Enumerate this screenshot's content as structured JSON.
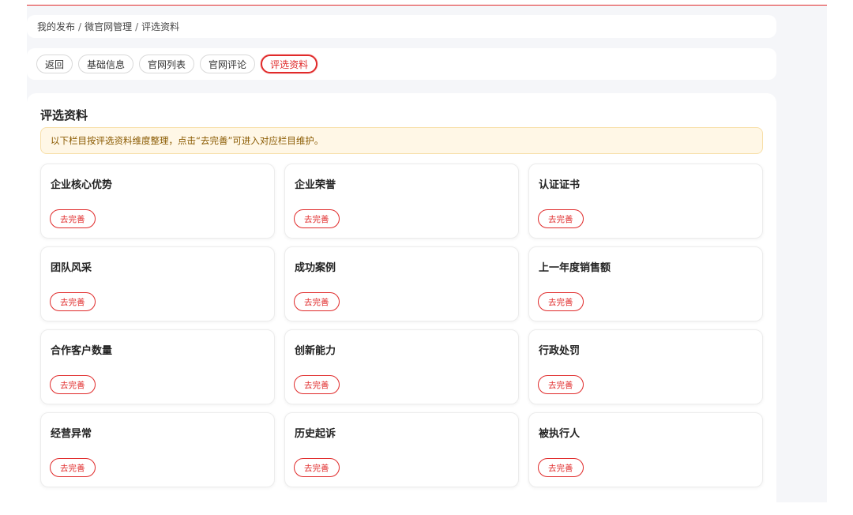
{
  "breadcrumb": {
    "items": [
      "我的发布",
      "微官网管理",
      "评选资料"
    ],
    "separator": "/"
  },
  "tabs": [
    {
      "label": "返回",
      "active": false
    },
    {
      "label": "基础信息",
      "active": false
    },
    {
      "label": "官网列表",
      "active": false
    },
    {
      "label": "官网评论",
      "active": false
    },
    {
      "label": "评选资料",
      "active": true
    }
  ],
  "panel": {
    "title": "评选资料",
    "notice": "以下栏目按评选资料维度整理，点击“去完善”可进入对应栏目维护。"
  },
  "cards": [
    {
      "title": "企业核心优势",
      "action": "去完善"
    },
    {
      "title": "企业荣誉",
      "action": "去完善"
    },
    {
      "title": "认证证书",
      "action": "去完善"
    },
    {
      "title": "团队风采",
      "action": "去完善"
    },
    {
      "title": "成功案例",
      "action": "去完善"
    },
    {
      "title": "上一年度销售额",
      "action": "去完善"
    },
    {
      "title": "合作客户数量",
      "action": "去完善"
    },
    {
      "title": "创新能力",
      "action": "去完善"
    },
    {
      "title": "行政处罚",
      "action": "去完善"
    },
    {
      "title": "经营异常",
      "action": "去完善"
    },
    {
      "title": "历史起诉",
      "action": "去完善"
    },
    {
      "title": "被执行人",
      "action": "去完善"
    }
  ],
  "colors": {
    "accent": "#e02a2a",
    "page_bg": "#f5f6f9",
    "notice_bg": "#fff7e6",
    "notice_text": "#8a5a00"
  }
}
